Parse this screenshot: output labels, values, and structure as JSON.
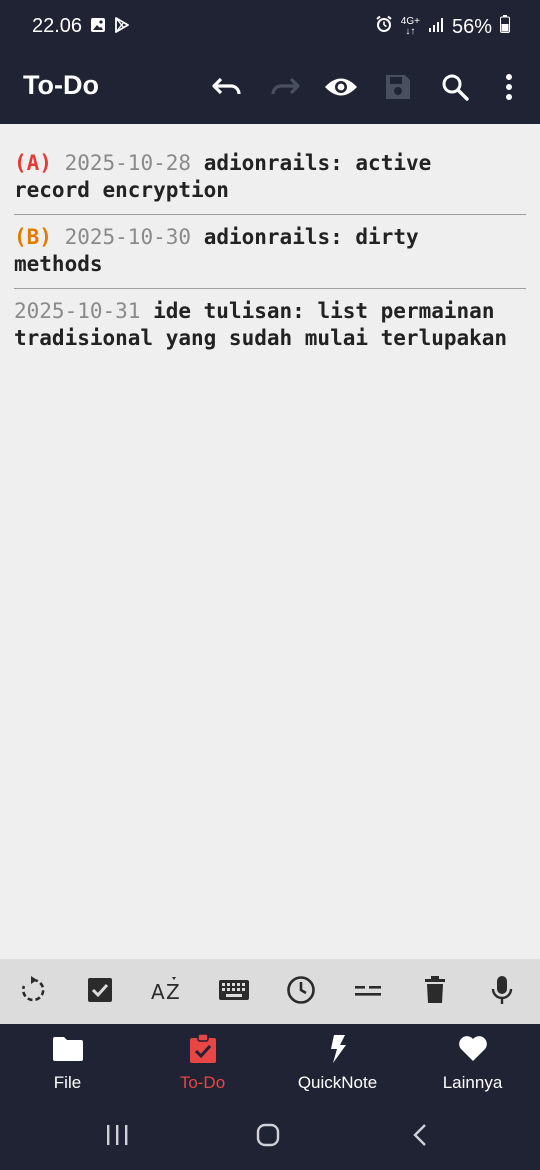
{
  "status_bar": {
    "time": "22.06",
    "network": "4G+",
    "battery": "56%",
    "icons": [
      "gallery-icon",
      "play-store-icon",
      "alarm-icon",
      "network-icon",
      "signal-icon",
      "battery-icon"
    ]
  },
  "app_bar": {
    "title": "To-Do",
    "actions": [
      "undo-icon",
      "redo-icon",
      "eye-icon",
      "save-icon",
      "search-icon",
      "more-vert-icon"
    ]
  },
  "tasks": [
    {
      "priority": "(A)",
      "date": "2025-10-28",
      "line1": "adionrails: active",
      "line2": "record encryption"
    },
    {
      "priority": "(B)",
      "date": "2025-10-30",
      "line1": "adionrails: dirty",
      "line2": "methods"
    },
    {
      "priority": "",
      "date": "2025-10-31",
      "line1": "ide tulisan: list permainan",
      "line2": "tradisional yang sudah mulai terlupakan"
    }
  ],
  "quick_toolbar": [
    "refresh-icon",
    "checkbox-icon",
    "sort-az-icon",
    "keyboard-icon",
    "clock-icon",
    "divider-lines-icon",
    "trash-icon",
    "mic-icon"
  ],
  "bottom_nav": {
    "items": [
      {
        "label": "File",
        "icon": "folder-icon"
      },
      {
        "label": "To-Do",
        "icon": "clipboard-check-icon"
      },
      {
        "label": "QuickNote",
        "icon": "lightning-icon"
      },
      {
        "label": "Lainnya",
        "icon": "heart-icon"
      }
    ],
    "active_index": 1,
    "active_color": "#e84545"
  },
  "colors": {
    "bar_background": "#1f2333",
    "content_background": "#efefef",
    "priority_a": "#e53935",
    "priority_b": "#e07b00",
    "date": "#8a8a8a"
  }
}
